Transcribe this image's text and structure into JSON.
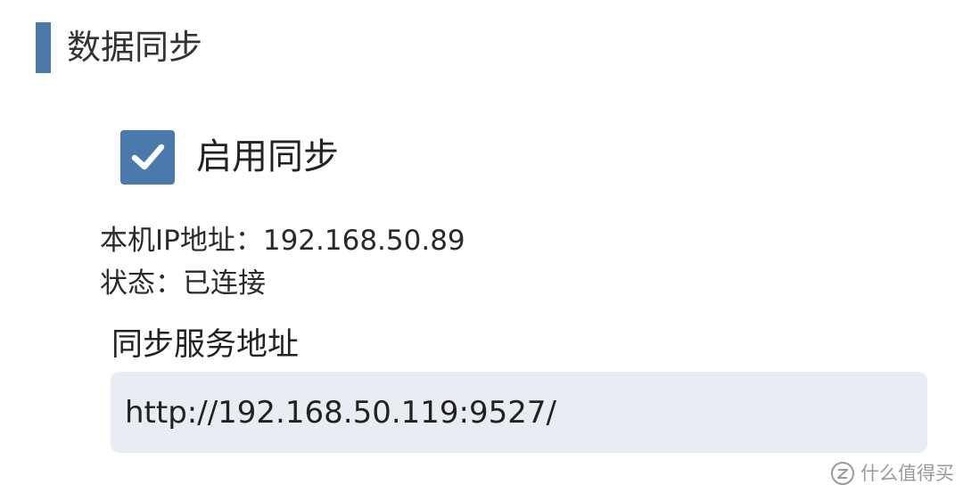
{
  "section": {
    "title": "数据同步"
  },
  "sync": {
    "enable_label": "启用同步",
    "enabled": true
  },
  "info": {
    "ip_label": "本机IP地址：",
    "ip_value": "192.168.50.89",
    "status_label": "状态：",
    "status_value": "已连接"
  },
  "server": {
    "label": "同步服务地址",
    "url_value": "http://192.168.50.119:9527/"
  },
  "watermark": {
    "text": "什么值得买",
    "logo_icon": "zhi-logo-icon"
  },
  "colors": {
    "accent": "#4a7aab",
    "field_background": "#e9edf3"
  }
}
